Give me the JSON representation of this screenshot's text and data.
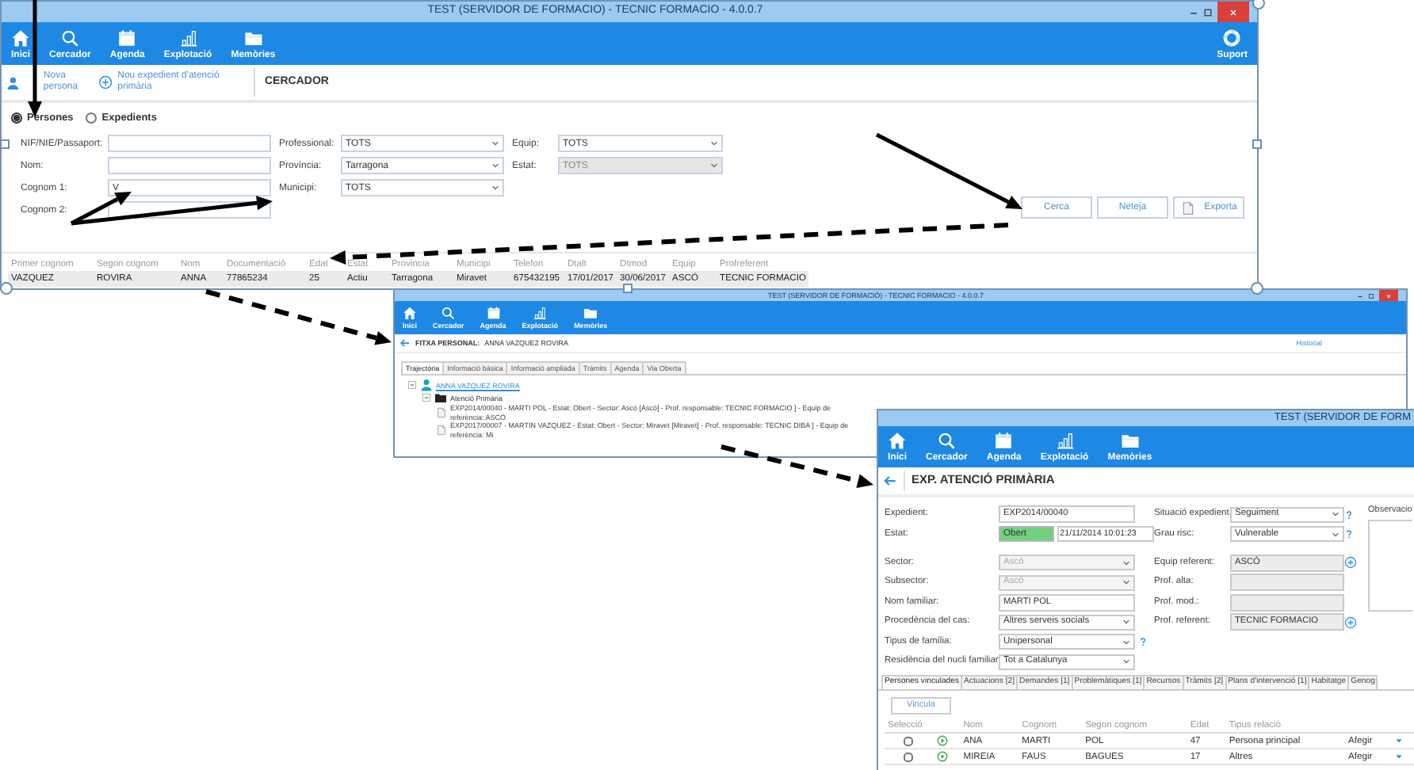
{
  "search_window": {
    "title": "TEST (SERVIDOR DE FORMACIO) - TECNIC FORMACIO - 4.0.0.7",
    "toolbar": [
      {
        "label": "Inici"
      },
      {
        "label": "Cercador"
      },
      {
        "label": "Agenda"
      },
      {
        "label": "Explotació"
      },
      {
        "label": "Memòries"
      }
    ],
    "support": {
      "label": "Suport"
    },
    "actions": [
      {
        "label": "Nova persona"
      },
      {
        "label": "Nou expedient d'atenció primària"
      }
    ],
    "section": "CERCADOR",
    "search_by": [
      {
        "label": "Persones",
        "selected": true
      },
      {
        "label": "Expedients",
        "selected": false
      }
    ],
    "field_columns": [
      [
        {
          "kind": "input",
          "label": "NIF/NIE/Passaport:"
        },
        {
          "kind": "input",
          "label": "Nom:"
        },
        {
          "kind": "input",
          "label": "Cognom 1:",
          "value": "V"
        },
        {
          "kind": "input",
          "label": "Cognom 2:"
        }
      ],
      [
        {
          "kind": "select",
          "label": "Professional:",
          "value": "TOTS",
          "disabled": false
        },
        {
          "kind": "select",
          "label": "Província:",
          "value": "Tarragona",
          "disabled": false
        },
        {
          "kind": "select",
          "label": "Municipi:",
          "value": "TOTS",
          "disabled": false
        }
      ],
      [
        {
          "kind": "select",
          "label": "Equip:",
          "value": "TOTS",
          "disabled": false
        },
        {
          "kind": "select",
          "label": "Estat:",
          "value": "TOTS",
          "disabled": true
        }
      ]
    ],
    "buttons": [
      {
        "kind": "plain",
        "label": "Cerca"
      },
      {
        "kind": "plain",
        "label": "Neteja"
      },
      {
        "kind": "export",
        "label": "Exporta"
      }
    ],
    "results": {
      "columns": [
        "Primer cognom",
        "Segon cognom",
        "Nom",
        "Documentació",
        "Edat",
        "Estat",
        "Provincia",
        "Municipi",
        "Telefon",
        "Dtalt",
        "Dtmod",
        "Equip",
        "Profreferent"
      ],
      "rows": [
        [
          "VAZQUEZ",
          "ROVIRA",
          "ANNA",
          "77865234",
          "25",
          "Actiu",
          "Tarragona",
          "Miravet",
          "675432195",
          "17/01/2017",
          "30/06/2017",
          "ASCÓ",
          "TECNIC FORMACIO"
        ]
      ]
    }
  },
  "person_window": {
    "title": "TEST (SERVIDOR DE FORMACIÓ) - TECNIC FORMACIO - 4.0.0.7",
    "toolbar": [
      {
        "label": "Inici"
      },
      {
        "label": "Cercador"
      },
      {
        "label": "Agenda"
      },
      {
        "label": "Explotació"
      },
      {
        "label": "Memòries"
      }
    ],
    "header_label": "FITXA PERSONAL:",
    "header_value": "ANNA VAZQUEZ ROVIRA",
    "history_link": "Historial",
    "tabs": [
      {
        "label": "Trajectòria",
        "selected": true
      },
      {
        "label": "Informació bàsica",
        "selected": false
      },
      {
        "label": "Informació ampliada",
        "selected": false
      },
      {
        "label": "Tràmits",
        "selected": false
      },
      {
        "label": "Agenda",
        "selected": false
      },
      {
        "label": "Via Oberta",
        "selected": false
      }
    ],
    "tree": [
      {
        "kind": "person",
        "label": "ANNA VAZQUEZ ROVIRA",
        "expanded": true,
        "children": [
          {
            "kind": "folder",
            "label": "Atenció Primària",
            "expanded": true,
            "children": [
              {
                "kind": "file",
                "label": "EXP2014/00040 - MARTI POL - Estat: Obert - Sector: Ascó [Ascó] - Prof. responsable: TECNIC FORMACIO ] - Equip de referència: ASCÓ"
              },
              {
                "kind": "file",
                "label": "EXP2017/00007 - MARTIN VAZQUEZ - Estat: Obert - Sector: Miravet [Miravet] - Prof. responsable: TECNIC DIBA ] - Equip de referència: Mi"
              }
            ]
          }
        ]
      }
    ]
  },
  "record_window": {
    "title": "TEST (SERVIDOR DE FORM",
    "toolbar": [
      {
        "label": "Inici"
      },
      {
        "label": "Cercador"
      },
      {
        "label": "Agenda"
      },
      {
        "label": "Explotació"
      },
      {
        "label": "Memòries"
      }
    ],
    "heading": "EXP. ATENCIÓ PRIMÀRIA",
    "left_groups": [
      [
        {
          "kind": "input",
          "label": "Expedient:",
          "value": "EXP2014/00040",
          "disabled": false
        },
        {
          "kind": "status",
          "label": "Estat:",
          "value": "Obert",
          "date": "21/11/2014 10:01:23"
        }
      ],
      [
        {
          "kind": "select",
          "label": "Sector:",
          "value": "Ascó",
          "disabled": true
        },
        {
          "kind": "select",
          "label": "Subsector:",
          "value": "Ascó",
          "disabled": true
        },
        {
          "kind": "input",
          "label": "Nom familiar:",
          "value": "MARTI POL",
          "disabled": false
        },
        {
          "kind": "select",
          "label": "Procedència del cas:",
          "value": "Altres serveis socials",
          "disabled": false
        },
        {
          "kind": "select",
          "label": "Tipus de família:",
          "value": "Unipersonal",
          "disabled": false,
          "help": true
        },
        {
          "kind": "select",
          "label": "Residència del nucli familiar:",
          "value": "Tot a Catalunya",
          "disabled": false
        }
      ]
    ],
    "right_groups": [
      [
        {
          "kind": "select",
          "label": "Situació expedient:",
          "value": "Seguiment",
          "disabled": false,
          "help": true
        },
        {
          "kind": "select",
          "label": "Grau risc:",
          "value": "Vulnerable",
          "disabled": false,
          "help": true
        }
      ],
      [
        {
          "kind": "input",
          "label": "Equip referent:",
          "value": "ASCÓ",
          "disabled": true,
          "add": true
        },
        {
          "kind": "input",
          "label": "Prof. alta:",
          "disabled": true
        },
        {
          "kind": "input",
          "label": "Prof. mod.:",
          "disabled": true
        },
        {
          "kind": "input",
          "label": "Prof. referent:",
          "value": "TECNIC FORMACIO",
          "disabled": true,
          "add": true
        }
      ]
    ],
    "notes_label": "Observacio",
    "tabs": [
      {
        "label": "Persones vinculades",
        "selected": true
      },
      {
        "label": "Actuacions [2]",
        "selected": false
      },
      {
        "label": "Demandes [1]",
        "selected": false
      },
      {
        "label": "Problemàtiques [1]",
        "selected": false
      },
      {
        "label": "Recursos",
        "selected": false
      },
      {
        "label": "Tràmits [2]",
        "selected": false
      },
      {
        "label": "Plans d'intervenció [1]",
        "selected": false
      },
      {
        "label": "Habitatge",
        "selected": false
      },
      {
        "label": "Genog",
        "selected": false
      }
    ],
    "link_button": "Vincula",
    "table": {
      "columns": [
        "Selecció",
        "Nom",
        "Cognom",
        "Segon cognom",
        "Edat",
        "Tipus relació"
      ],
      "rows": [
        {
          "checked": false,
          "cells": [
            "",
            "ANA",
            "MARTI",
            "POL",
            "47",
            "Persona principal"
          ],
          "action": "Afegir"
        },
        {
          "checked": false,
          "cells": [
            "",
            "MIREIA",
            "FAUS",
            "BAGUES",
            "17",
            "Altres"
          ],
          "action": "Afegir"
        }
      ]
    }
  }
}
